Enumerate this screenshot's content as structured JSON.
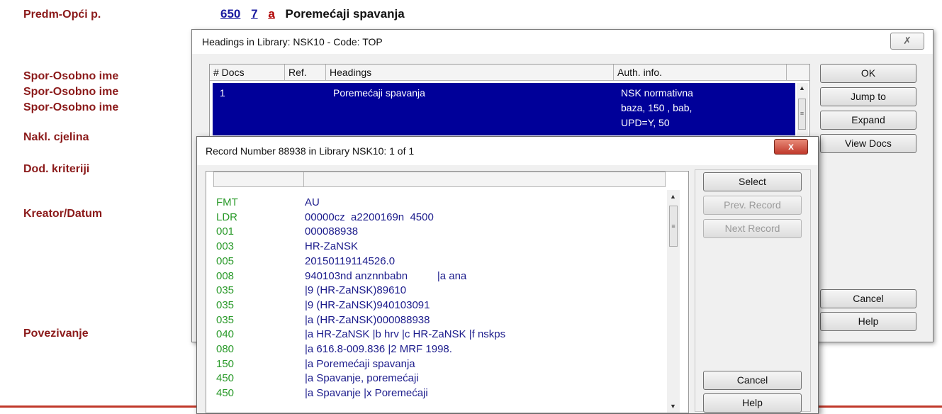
{
  "background": {
    "labels": [
      "Predm-Opći p.",
      "Spor-Osobno ime",
      "Spor-Osobno ime",
      "Spor-Osobno ime",
      "Nakl. cjelina",
      "Dod. kriteriji",
      "Kreator/Datum",
      "Povezivanje"
    ],
    "field": {
      "tag": "650",
      "ind": "7",
      "sub": "a",
      "value": "Poremećaji spavanja"
    }
  },
  "headings_dialog": {
    "title": "Headings in Library: NSK10 - Code: TOP",
    "close_glyph": "✗",
    "columns": [
      "# Docs",
      "Ref.",
      "Headings",
      "Auth. info."
    ],
    "rows": [
      {
        "docs": "1",
        "ref": "",
        "heading": "Poremećaji spavanja",
        "auth_lines": [
          "NSK normativna",
          "baza, 150 , bab,",
          "UPD=Y, 50"
        ]
      }
    ],
    "buttons": [
      "OK",
      "Jump to",
      "Expand",
      "View Docs",
      "Cancel",
      "Help"
    ]
  },
  "record_dialog": {
    "title": "Record Number 88938 in Library NSK10: 1 of 1",
    "close_glyph": "x",
    "rows": [
      {
        "tag": "FMT",
        "value": "AU"
      },
      {
        "tag": "LDR",
        "value": "00000cz  a2200169n  4500"
      },
      {
        "tag": "001",
        "value": "000088938"
      },
      {
        "tag": "003",
        "value": "HR-ZaNSK"
      },
      {
        "tag": "005",
        "value": "20150119114526.0"
      },
      {
        "tag": "008",
        "value": "940103nd anznnbabn          |a ana"
      },
      {
        "tag": "035",
        "value": "|9 (HR-ZaNSK)89610"
      },
      {
        "tag": "035",
        "value": "|9 (HR-ZaNSK)940103091"
      },
      {
        "tag": "035",
        "value": "|a (HR-ZaNSK)000088938"
      },
      {
        "tag": "040",
        "value": "|a HR-ZaNSK |b hrv |c HR-ZaNSK |f nskps"
      },
      {
        "tag": "080",
        "value": "|a 616.8-009.836 |2 MRF 1998."
      },
      {
        "tag": "150",
        "value": "|a Poremećaji spavanja"
      },
      {
        "tag": "450",
        "value": "|a Spavanje, poremećaji"
      },
      {
        "tag": "450",
        "value": "|a Spavanje |x Poremećaji"
      }
    ],
    "buttons": {
      "select": "Select",
      "prev": "Prev. Record",
      "next": "Next Record",
      "cancel": "Cancel",
      "help": "Help"
    }
  },
  "colors": {
    "label_red": "#8b1a1a",
    "selection_blue": "#000099",
    "tag_green": "#2a9a2a",
    "value_blue": "#1c1c8c"
  }
}
